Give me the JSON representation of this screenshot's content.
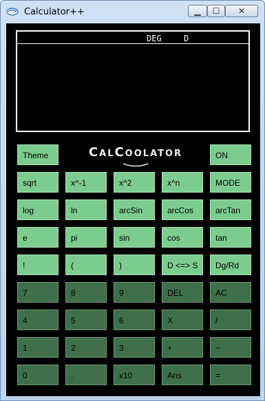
{
  "window": {
    "title": "Calculator++",
    "controls": {
      "minimize": "▁",
      "maximize": "☐",
      "close": "✕"
    }
  },
  "display": {
    "indicators": {
      "angle": "DEG",
      "mode": "D"
    }
  },
  "logo": "CalCoolator",
  "keys": {
    "theme": "Theme",
    "on": "ON",
    "sqrt": "sqrt",
    "x_inv": "x^-1",
    "x_sq": "x^2",
    "x_pow": "x^n",
    "mode": "MODE",
    "log": "log",
    "ln": "ln",
    "arcsin": "arcSin",
    "arccos": "arcCos",
    "arctan": "arcTan",
    "e": "e",
    "pi": "pi",
    "sin": "sin",
    "cos": "cos",
    "tan": "tan",
    "fact": "!",
    "lparen": "(",
    "rparen": ")",
    "dtos": "D <=> S",
    "dgrd": "Dg/Rd",
    "seven": "7",
    "eight": "8",
    "nine": "9",
    "del": "DEL",
    "ac": "AC",
    "four": "4",
    "five": "5",
    "six": "6",
    "mul": "X",
    "div": "/",
    "one": "1",
    "two": "2",
    "three": "3",
    "plus": "+",
    "minus": "−",
    "zero": "0",
    "dot": ".",
    "x10": "x10",
    "ans": "Ans",
    "equals": "="
  }
}
